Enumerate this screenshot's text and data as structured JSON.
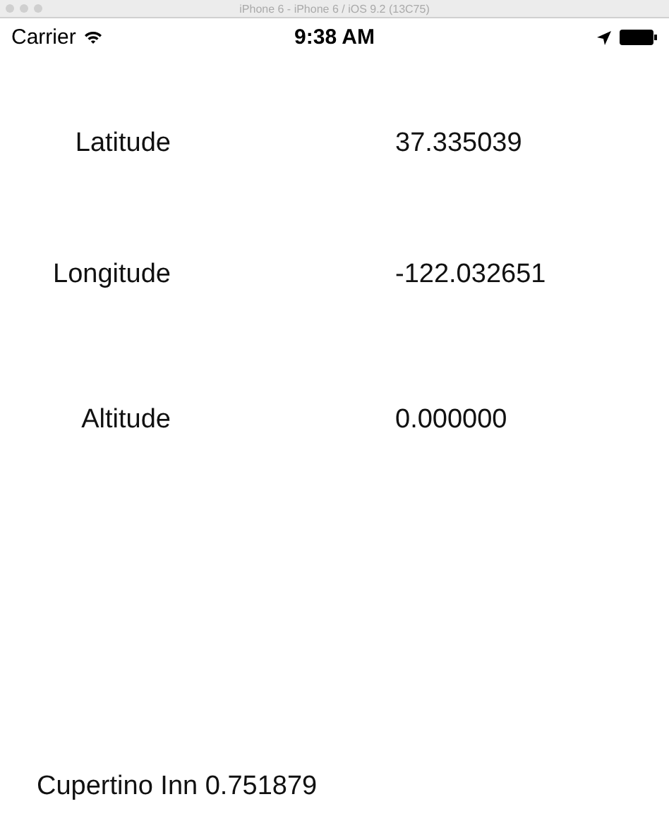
{
  "window": {
    "title": "iPhone 6 - iPhone 6 / iOS 9.2 (13C75)"
  },
  "status_bar": {
    "carrier": "Carrier",
    "time": "9:38 AM"
  },
  "rows": [
    {
      "label": "Latitude",
      "value": "37.335039"
    },
    {
      "label": "Longitude",
      "value": "-122.032651"
    },
    {
      "label": "Altitude",
      "value": "0.000000"
    }
  ],
  "footer": "Cupertino Inn 0.751879"
}
